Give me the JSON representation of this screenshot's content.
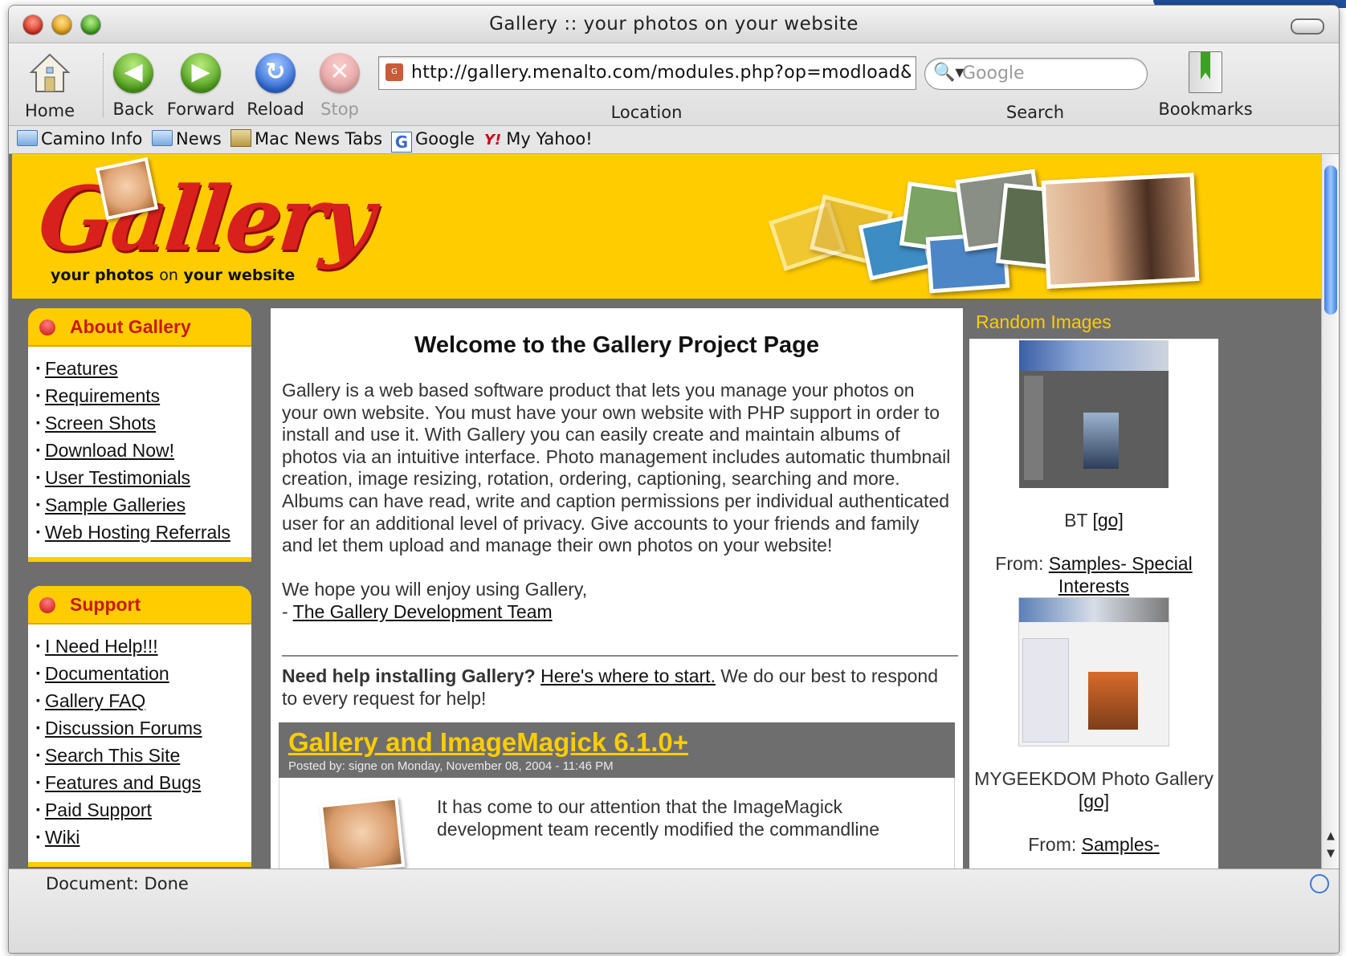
{
  "window": {
    "title": "Gallery :: your photos on your website"
  },
  "toolbar": {
    "home": "Home",
    "back": "Back",
    "forward": "Forward",
    "reload": "Reload",
    "stop": "Stop",
    "url": "http://gallery.menalto.com/modules.php?op=modload&",
    "location_label": "Location",
    "search_placeholder": "Google",
    "search_label": "Search",
    "bookmarks": "Bookmarks"
  },
  "bookmarks_bar": [
    "Camino Info",
    "News",
    "Mac News Tabs",
    "Google",
    "My Yahoo!"
  ],
  "header": {
    "logo": "Gallery",
    "tag_a": "your photos",
    "tag_on": "on",
    "tag_b": "your website"
  },
  "about_box": {
    "title": "About Gallery",
    "items": [
      "Features",
      "Requirements",
      "Screen Shots",
      "Download Now!",
      "User Testimonials",
      "Sample Galleries",
      "Web Hosting Referrals"
    ]
  },
  "support_box": {
    "title": "Support",
    "items": [
      "I Need Help!!!",
      "Documentation",
      "Gallery FAQ",
      "Discussion Forums",
      "Search This Site",
      "Features and Bugs",
      "Paid Support",
      "Wiki"
    ]
  },
  "main": {
    "welcome": "Welcome to the Gallery Project Page",
    "intro": "Gallery is a web based software product that lets you manage your photos on your own website. You must have your own website with PHP support in order to install and use it. With Gallery you can easily create and maintain albums of photos via an intuitive interface. Photo management includes automatic thumbnail creation, image resizing, rotation, ordering, captioning, searching and more. Albums can have read, write and caption permissions per individual authenticated user for an additional level of privacy. Give accounts to your friends and family and let them upload and manage their own photos on your website!",
    "hope": "We hope you will enjoy using Gallery,",
    "dash": "- ",
    "team_link": "The Gallery Development Team",
    "help_bold": "Need help installing Gallery?",
    "help_link": "Here's where to start.",
    "help_rest": "We do our best to respond to every request for help!",
    "news_title": "Gallery and ImageMagick 6.1.0+",
    "news_meta": "Posted by: signe on Monday, November 08, 2004 - 11:46 PM",
    "news_body": "It has come to our attention that the ImageMagick development team recently modified the commandline"
  },
  "random": {
    "title": "Random Images",
    "img1_caption": "BT",
    "img1_go": "[go]",
    "from_label": "From:",
    "img1_from": "Samples- Special Interests",
    "img2_caption": "MYGEEKDOM Photo Gallery",
    "img2_go": "[go]",
    "img2_from": "Samples-"
  },
  "status": {
    "text": "Document: Done"
  }
}
